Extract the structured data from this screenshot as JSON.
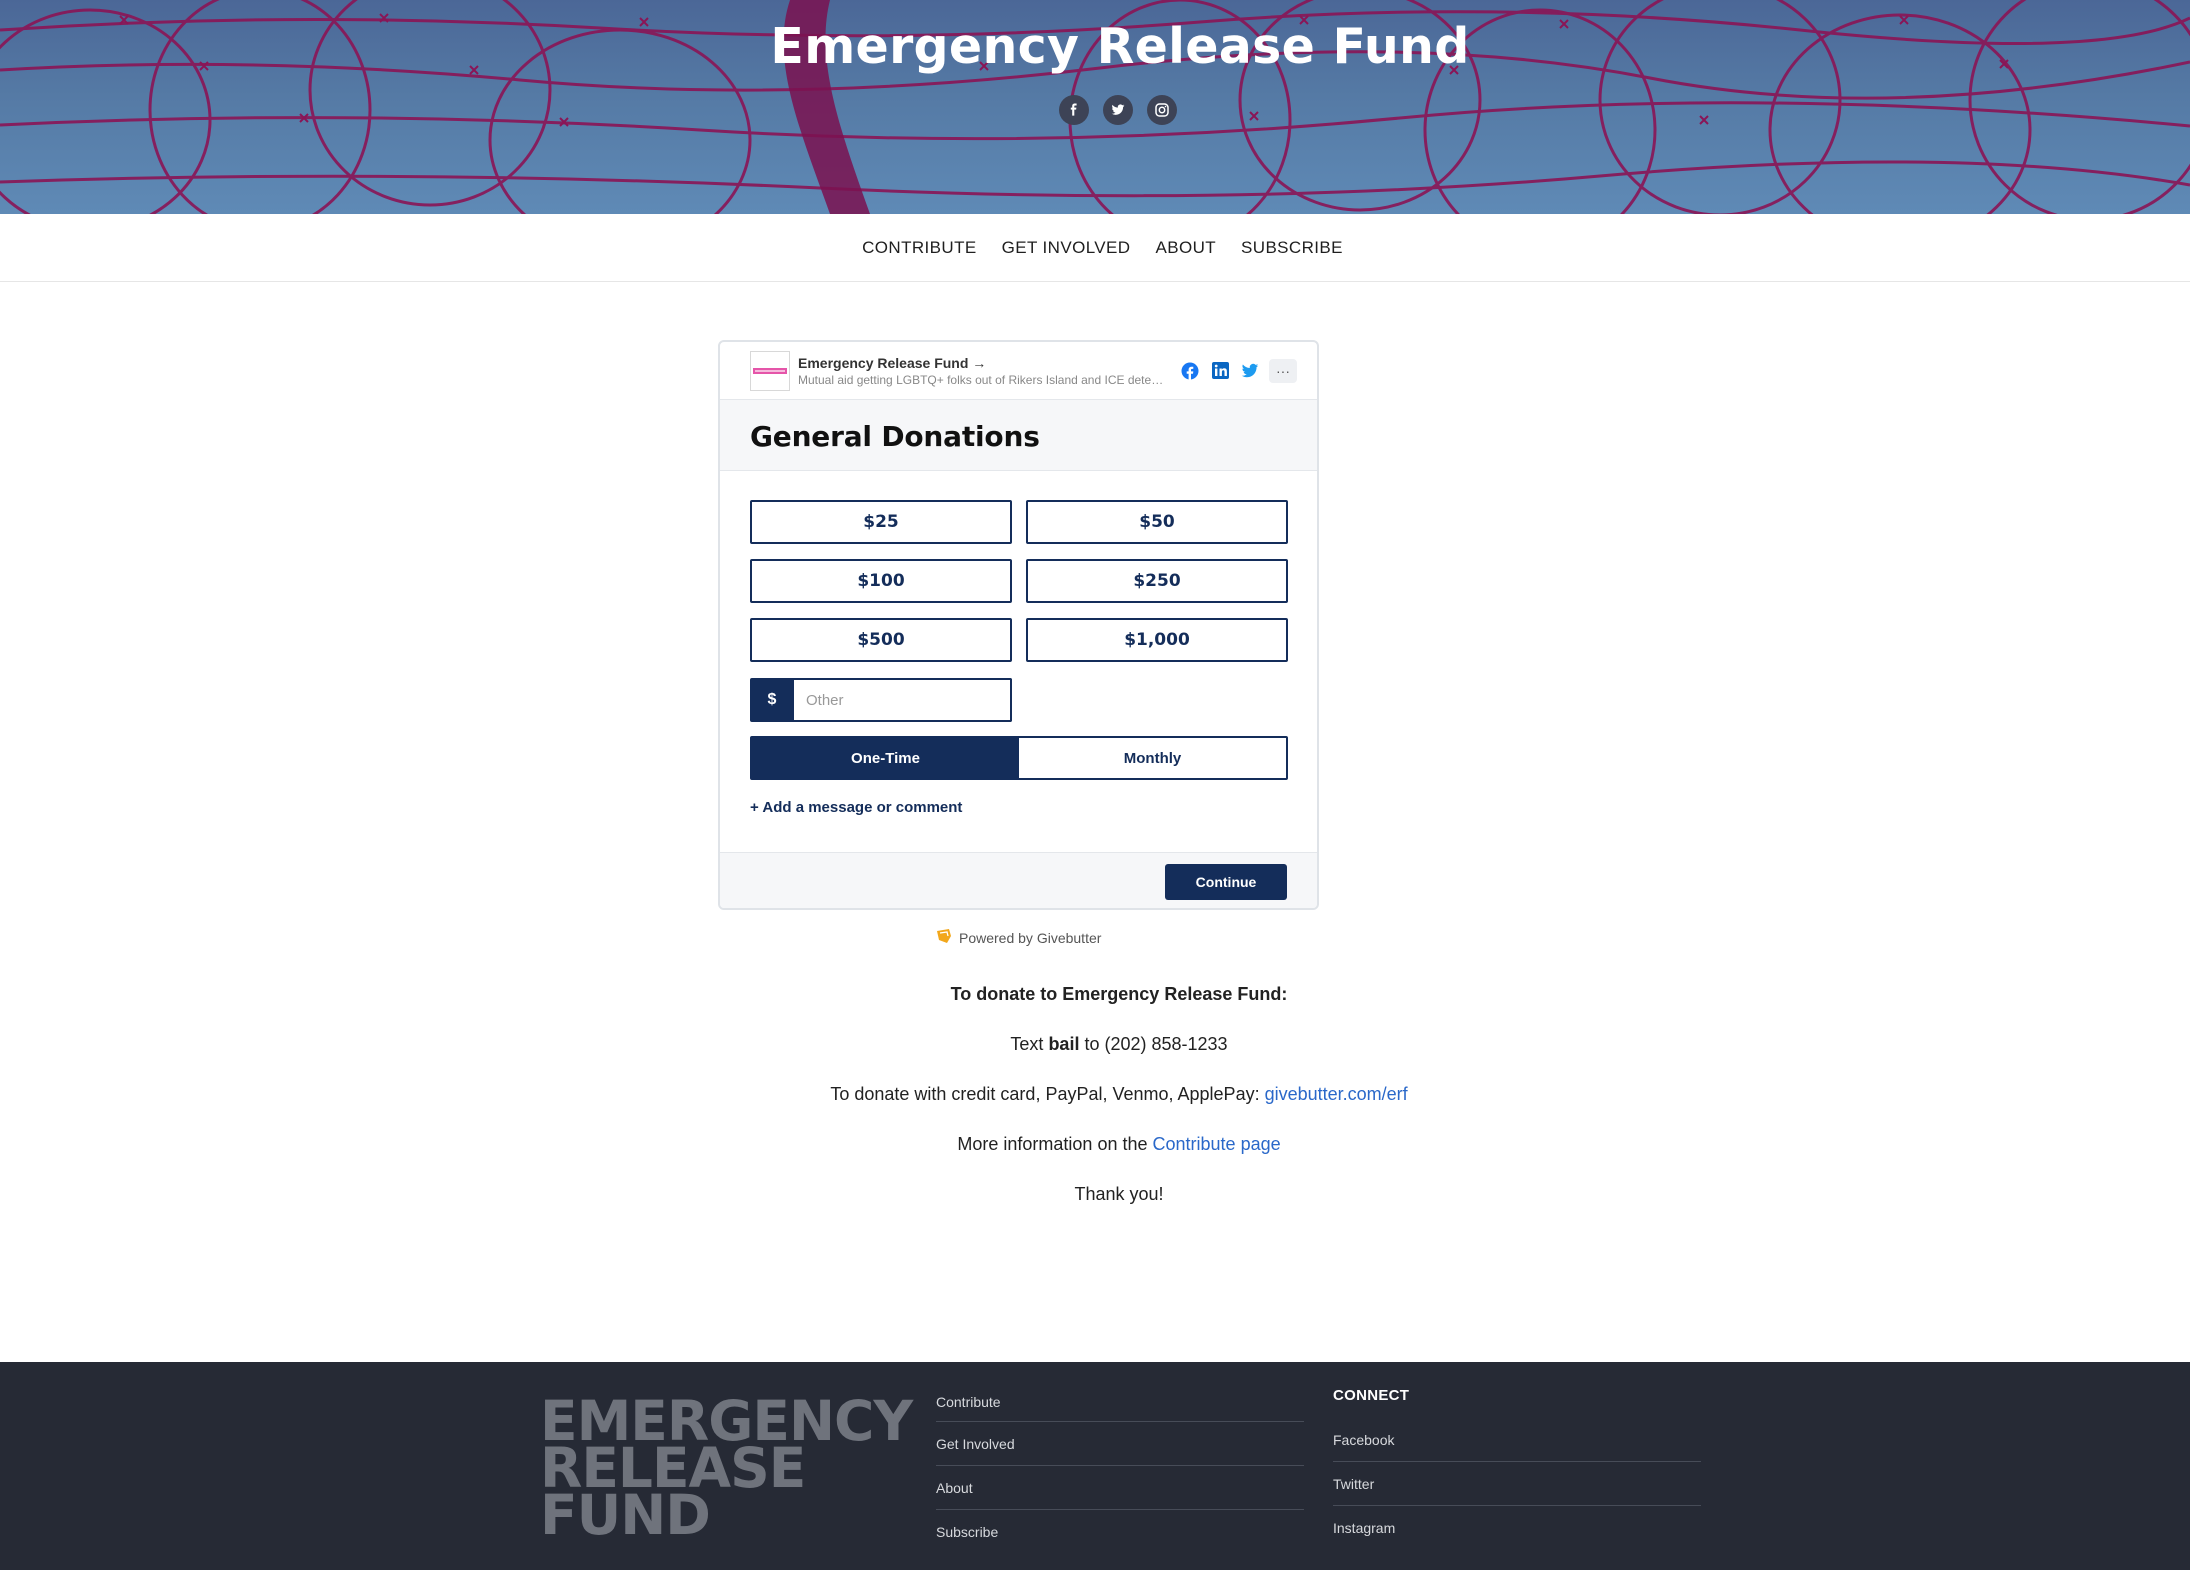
{
  "hero": {
    "title": "Emergency Release Fund",
    "social_icons": [
      "facebook-icon",
      "twitter-icon",
      "instagram-icon"
    ]
  },
  "nav": {
    "items": [
      "CONTRIBUTE",
      "GET INVOLVED",
      "ABOUT",
      "SUBSCRIBE"
    ]
  },
  "widget": {
    "org_name": "Emergency Release Fund →",
    "org_description": "Mutual aid getting LGBTQ+ folks out of Rikers Island and ICE detention",
    "share_icons": [
      "facebook-icon",
      "linkedin-icon",
      "twitter-icon",
      "more-icon"
    ],
    "title": "General Donations",
    "amounts": [
      "$25",
      "$50",
      "$100",
      "$250",
      "$500",
      "$1,000"
    ],
    "currency_symbol": "$",
    "other_placeholder": "Other",
    "frequency": {
      "one_time": "One-Time",
      "monthly": "Monthly",
      "selected": "One-Time"
    },
    "add_message": "+ Add a message or comment",
    "continue": "Continue",
    "powered_by": "Powered by Givebutter"
  },
  "info": {
    "heading": "To donate to Emergency Release Fund:",
    "text_prefix": "Text",
    "text_keyword": "bail",
    "text_suffix": "to (202) 858-1233",
    "credit_prefix": "To donate with credit card, PayPal, Venmo, ApplePay:",
    "credit_link": "givebutter.com/erf",
    "more_prefix": "More information on the",
    "more_link": "Contribute page",
    "thanks": "Thank you!"
  },
  "footer": {
    "logo_lines": [
      "EMERGENCY",
      "RELEASE",
      "FUND"
    ],
    "links": [
      "Contribute",
      "Get Involved",
      "About",
      "Subscribe"
    ],
    "connect_heading": "CONNECT",
    "connect_links": [
      "Facebook",
      "Twitter",
      "Instagram"
    ]
  },
  "colors": {
    "brand_navy": "#142d5a",
    "hero_sky": "#557aa5",
    "barbed_wire": "#8a1556",
    "footer_bg": "#262a35",
    "link_blue": "#2a68c9"
  }
}
